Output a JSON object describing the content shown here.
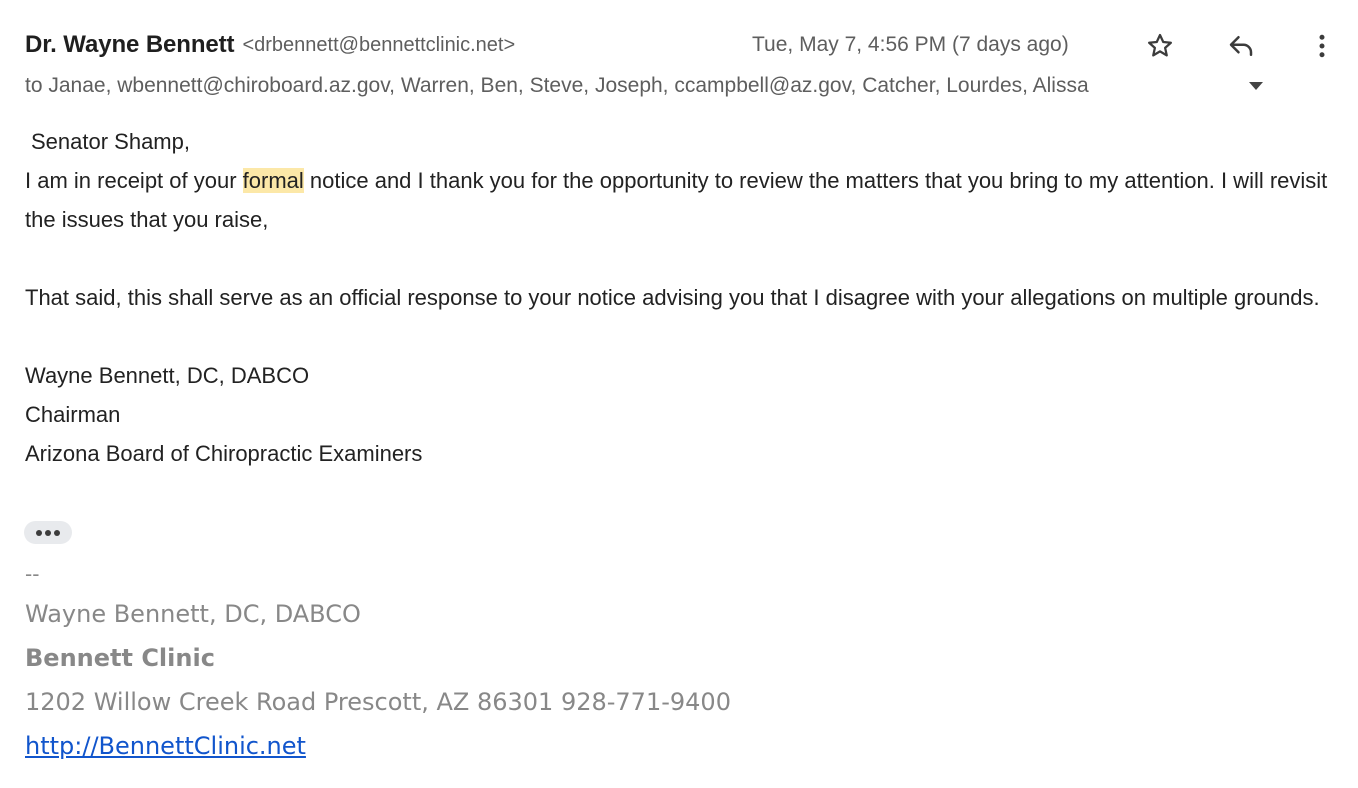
{
  "header": {
    "sender_name": "Dr. Wayne Bennett",
    "sender_email": "<drbennett@bennettclinic.net>",
    "date": "Tue, May 7, 4:56 PM (7 days ago)",
    "recipients": "to Janae, wbennett@chiroboard.az.gov, Warren, Ben, Steve, Joseph, ccampbell@az.gov, Catcher, Lourdes, Alissa",
    "icons": [
      "star-icon",
      "reply-icon",
      "more-vert-icon",
      "expand-recipients-icon"
    ]
  },
  "body": {
    "salutation": "Senator Shamp,",
    "para1_before": "I am in receipt of your ",
    "para1_highlight": "formal",
    "para1_after": " notice and I thank you for the opportunity to review the matters that you bring to my attention.  I will revisit the issues that you raise,",
    "para2": "That said, this shall serve as an official response to your notice advising you that I disagree with your allegations on multiple grounds.",
    "signature_name": "Wayne Bennett, DC, DABCO",
    "signature_title": "Chairman",
    "signature_org": "Arizona Board of Chiropractic Examiners"
  },
  "trimmed_content_icon": "more-horiz-icon",
  "signature": {
    "dashes": "--",
    "name": "Wayne Bennett, DC, DABCO",
    "clinic": "Bennett Clinic",
    "address": "1202 Willow Creek Road Prescott, AZ 86301 928-771-9400",
    "link": "http://BennettClinic.net"
  },
  "colors": {
    "highlight": "#fce8a8",
    "link": "#1155cc",
    "signature_gray": "#888888",
    "meta_gray": "#5e5e5e"
  }
}
